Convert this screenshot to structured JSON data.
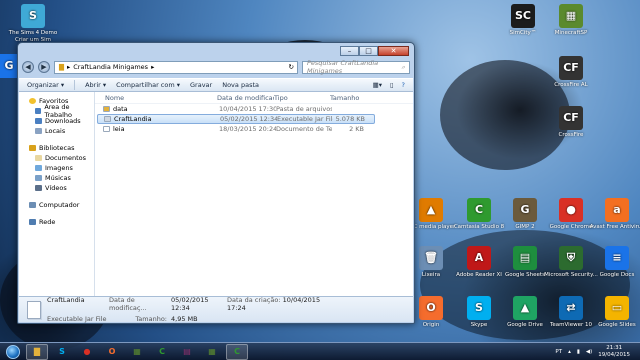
{
  "desktop_icons": [
    {
      "id": "sims",
      "label": "The Sims 4 Demo\nCriar um Sim",
      "glyph": "S",
      "color": "#3fa9d6"
    },
    {
      "id": "simcity",
      "label": "SimCity™",
      "glyph": "SC",
      "color": "#1c1c1c"
    },
    {
      "id": "minecraft",
      "label": "MinecraftSP",
      "glyph": "▦",
      "color": "#5b8a2e"
    },
    {
      "id": "crossfire-al",
      "label": "CrossFire AL",
      "glyph": "CF",
      "color": "#333"
    },
    {
      "id": "crossfire",
      "label": "CrossFire",
      "glyph": "CF",
      "color": "#333"
    },
    {
      "id": "vlc",
      "label": "VLC media player",
      "glyph": "▲",
      "color": "#e07b00"
    },
    {
      "id": "camtasia",
      "label": "Camtasia Studio 8",
      "glyph": "C",
      "color": "#2f9a2f"
    },
    {
      "id": "gimp",
      "label": "GIMP 2",
      "glyph": "G",
      "color": "#6b5a3c"
    },
    {
      "id": "chrome",
      "label": "Google Chrome",
      "glyph": "●",
      "color": "#d93025"
    },
    {
      "id": "avast",
      "label": "Avast Free Antivirus",
      "glyph": "a",
      "color": "#f36f21"
    },
    {
      "id": "lixeira",
      "label": "Lixeira",
      "glyph": "🗑",
      "color": "#6c8eb4"
    },
    {
      "id": "adobe",
      "label": "Adobe Reader XI",
      "glyph": "A",
      "color": "#c01818"
    },
    {
      "id": "sheets",
      "label": "Google Sheets",
      "glyph": "▤",
      "color": "#1e8e3e"
    },
    {
      "id": "mse",
      "label": "Microsoft Security...",
      "glyph": "⛨",
      "color": "#2c6b2f"
    },
    {
      "id": "docs",
      "label": "Google Docs",
      "glyph": "≡",
      "color": "#1a73e8"
    },
    {
      "id": "origin",
      "label": "Origin",
      "glyph": "O",
      "color": "#f56c2d"
    },
    {
      "id": "skype",
      "label": "Skype",
      "glyph": "S",
      "color": "#00aff0"
    },
    {
      "id": "drive",
      "label": "Google Drive",
      "glyph": "▲",
      "color": "#1fa463"
    },
    {
      "id": "teamviewer",
      "label": "TeamViewer 10",
      "glyph": "⇄",
      "color": "#0e6ab4"
    },
    {
      "id": "slides",
      "label": "Google Slides",
      "glyph": "▭",
      "color": "#f4b400"
    }
  ],
  "desktop_left_extra": {
    "label": "Goo"
  },
  "window": {
    "path": [
      "CraftLandia Minigames"
    ],
    "search_placeholder": "Pesquisar CraftLandia Minigames",
    "toolbar": [
      "Organizar ▾",
      "Abrir ▾",
      "Compartilhar com ▾",
      "Gravar",
      "Nova pasta"
    ],
    "nav": {
      "favorites": {
        "label": "Favoritos",
        "items": [
          "Área de Trabalho",
          "Downloads",
          "Locais"
        ]
      },
      "libraries": {
        "label": "Bibliotecas",
        "items": [
          "Documentos",
          "Imagens",
          "Músicas",
          "Vídeos"
        ]
      },
      "computer": "Computador",
      "network": "Rede"
    },
    "columns": [
      "Nome",
      "Data de modificaç...",
      "Tipo",
      "Tamanho"
    ],
    "files": [
      {
        "name": "data",
        "date": "10/04/2015 17:30",
        "type": "Pasta de arquivos",
        "size": "",
        "kind": "folder",
        "selected": false
      },
      {
        "name": "CraftLandia",
        "date": "05/02/2015 12:34",
        "type": "Executable Jar File",
        "size": "5.078 KB",
        "kind": "jar",
        "selected": true
      },
      {
        "name": "leia",
        "date": "18/03/2015 20:24",
        "type": "Documento de Te...",
        "size": "2 KB",
        "kind": "txt",
        "selected": false
      }
    ],
    "details": {
      "name": "CraftLandia",
      "type": "Executable Jar File",
      "modified_label": "Data de modificaç...",
      "modified": "05/02/2015 12:34",
      "created_label": "Data da criação:",
      "created": "10/04/2015 17:24",
      "size_label": "Tamanho:",
      "size": "4,95 MB"
    }
  },
  "taskbar": {
    "items": [
      "explorer",
      "skype",
      "chrome",
      "origin",
      "minecraft",
      "camtasia",
      "winrar",
      "minecraft2",
      "camtasia2"
    ],
    "lang": "PT",
    "time": "21:31",
    "date": "19/04/2015"
  }
}
